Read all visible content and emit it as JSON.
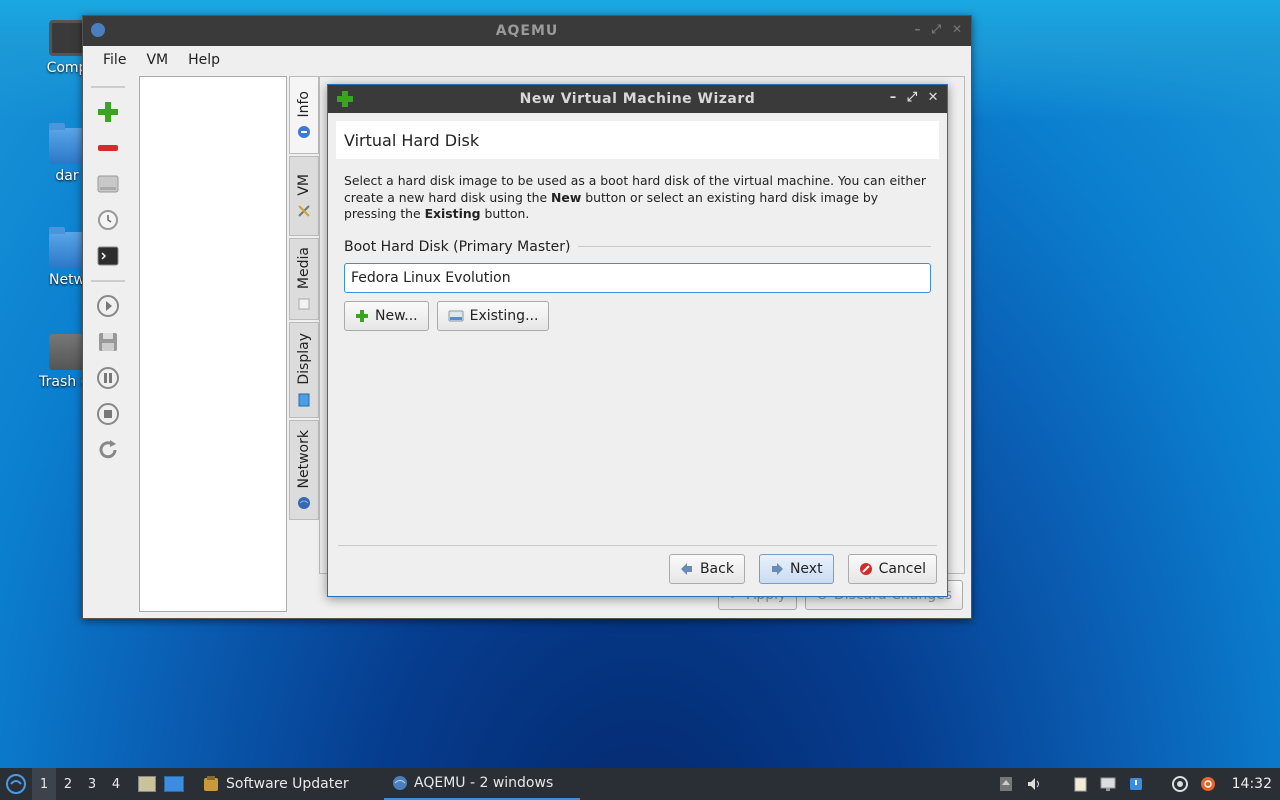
{
  "desktop": {
    "icons": [
      {
        "label": "Comp"
      },
      {
        "label": "dar"
      },
      {
        "label": "Netw"
      },
      {
        "label": "Trash (E"
      }
    ]
  },
  "main_window": {
    "title": "AQEMU",
    "menu": [
      "File",
      "VM",
      "Help"
    ],
    "tabs": [
      {
        "label": "Info",
        "icon": "info-icon"
      },
      {
        "label": "VM",
        "icon": "tools-icon"
      },
      {
        "label": "Media",
        "icon": "media-icon"
      },
      {
        "label": "Display",
        "icon": "display-icon"
      },
      {
        "label": "Network",
        "icon": "network-icon"
      }
    ],
    "apply_label": "Apply",
    "discard_label": "Discard Changes"
  },
  "wizard": {
    "title": "New Virtual Machine Wizard",
    "page_title": "Virtual Hard Disk",
    "desc_part1": "Select a hard disk image to be used as a boot hard disk of the virtual machine. You can either create a new hard disk using the ",
    "desc_bold1": "New",
    "desc_part2": " button or select an existing hard disk image by pressing the ",
    "desc_bold2": "Existing",
    "desc_part3": " button.",
    "group_label": "Boot Hard Disk (Primary Master)",
    "disk_value": "Fedora Linux Evolution",
    "new_label": "New...",
    "existing_label": "Existing...",
    "back_label": "Back",
    "next_label": "Next",
    "cancel_label": "Cancel"
  },
  "taskbar": {
    "workspaces": [
      "1",
      "2",
      "3",
      "4"
    ],
    "tasks": [
      {
        "label": "Software Updater"
      },
      {
        "label": "AQEMU - 2 windows"
      }
    ],
    "clock": "14:32"
  }
}
